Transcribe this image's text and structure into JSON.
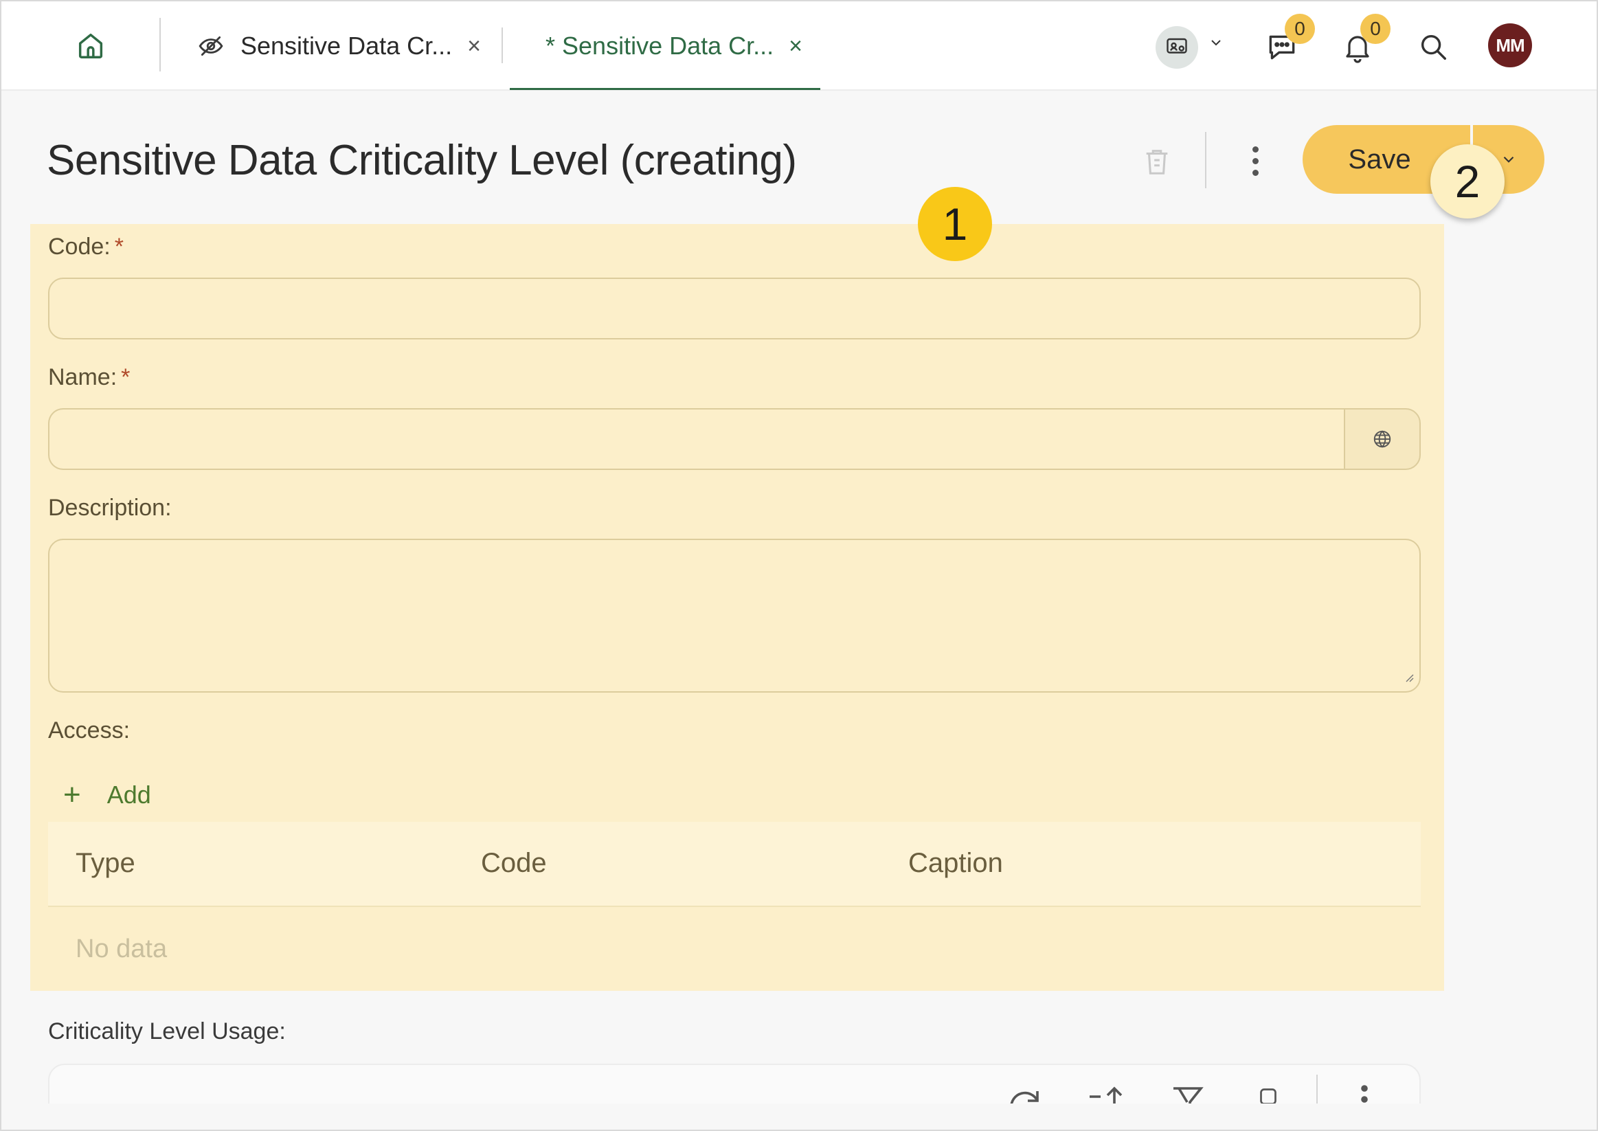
{
  "tabs": [
    {
      "label": "Sensitive Data Cr...",
      "icon": "eye-off-icon",
      "active": false
    },
    {
      "label": "* Sensitive Data Cr...",
      "active": true
    }
  ],
  "tab_close_glyph": "×",
  "header_icons": {
    "workspace": "workspace-switch-icon",
    "chat": "chat-icon",
    "notifications": "bell-icon",
    "search": "search-icon"
  },
  "badges": {
    "chat": "0",
    "notifications": "0"
  },
  "avatar": {
    "initials": "MM",
    "color": "#6b1f1f"
  },
  "page": {
    "title": "Sensitive Data Criticality Level (creating)"
  },
  "actions": {
    "save_label": "Save"
  },
  "markers": {
    "first": "1",
    "second": "2"
  },
  "form": {
    "code": {
      "label": "Code:",
      "required_mark": "*",
      "value": ""
    },
    "name": {
      "label": "Name:",
      "required_mark": "*",
      "value": ""
    },
    "description": {
      "label": "Description:",
      "value": ""
    },
    "access": {
      "label": "Access:",
      "add_label": "Add",
      "add_glyph": "+",
      "columns": [
        "Type",
        "Code",
        "Caption"
      ],
      "empty_text": "No data"
    }
  },
  "usage": {
    "label": "Criticality Level Usage:"
  },
  "colors": {
    "accent": "#2f6b45",
    "save": "#f6c75c",
    "highlight": "#fcefca",
    "marker": "#f9c818",
    "badge": "#f4c552"
  }
}
